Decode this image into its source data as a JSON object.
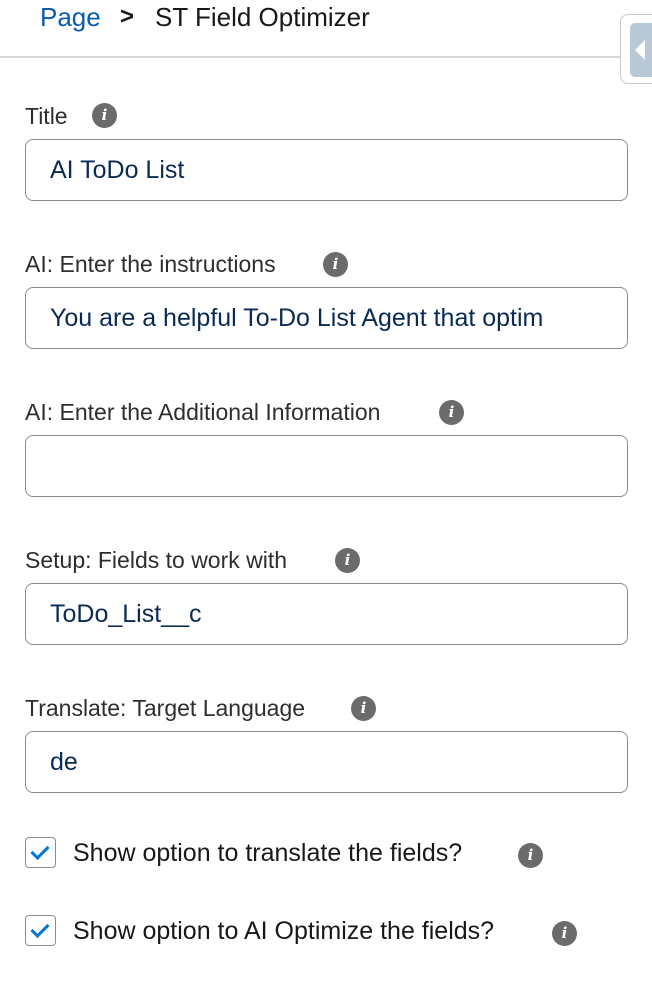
{
  "breadcrumb": {
    "parent": "Page",
    "separator": ">",
    "current": "ST Field Optimizer"
  },
  "fields": {
    "title": {
      "label": "Title",
      "value": "AI ToDo List"
    },
    "instructions": {
      "label": "AI: Enter the instructions",
      "value": "You are a helpful To-Do List Agent that optim"
    },
    "additional_info": {
      "label": "AI: Enter the Additional Information",
      "value": ""
    },
    "fields_to_work": {
      "label": "Setup: Fields to work with",
      "value": "ToDo_List__c"
    },
    "target_language": {
      "label": "Translate: Target Language",
      "value": "de"
    }
  },
  "checkboxes": {
    "translate": {
      "label": "Show option to translate the fields?",
      "checked": true
    },
    "optimize": {
      "label": "Show option to AI Optimize the fields?",
      "checked": true
    }
  },
  "icons": {
    "info": "i",
    "info_icon_name": "info-icon",
    "collapse_icon_name": "chevron-left-icon"
  },
  "colors": {
    "link": "#0b5cab",
    "checkmark": "#0176d3",
    "input_text": "#0a2a55",
    "info_icon_bg": "#6b6b6b",
    "collapse_tab": "#b9c8d6"
  }
}
